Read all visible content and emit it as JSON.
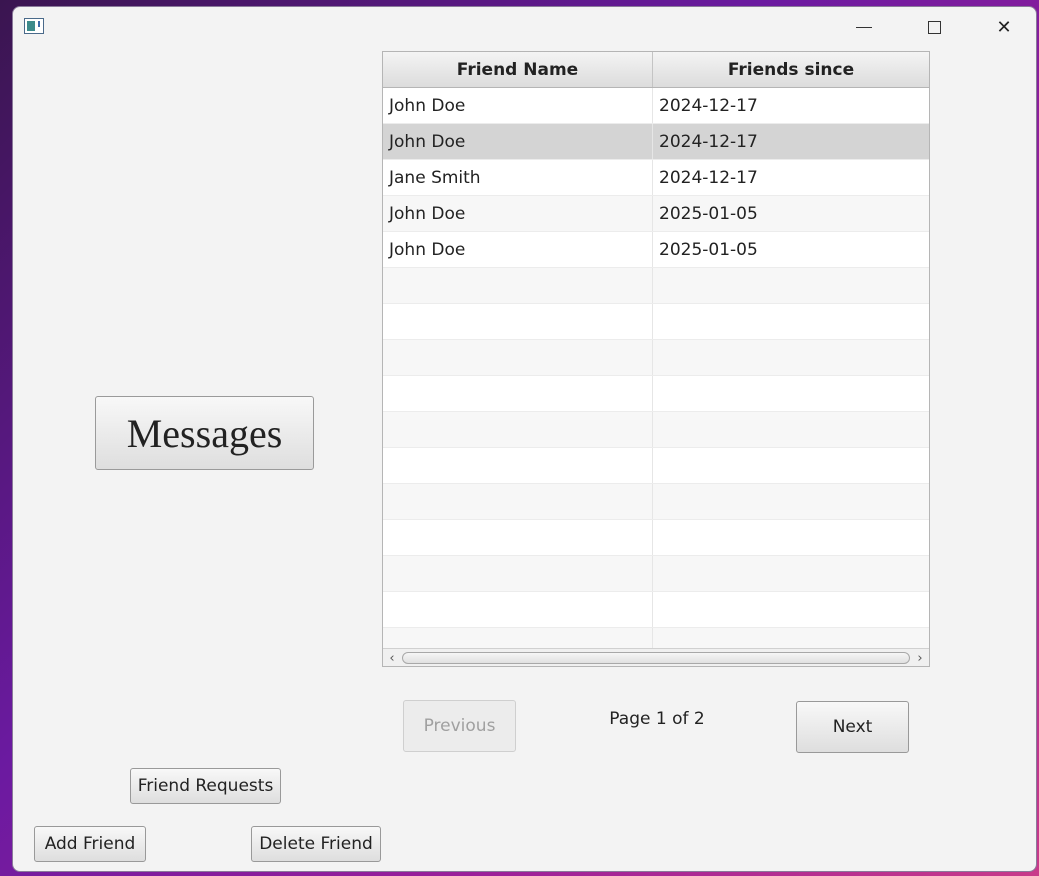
{
  "window": {
    "controls": {
      "minimize": "minimize",
      "maximize": "maximize",
      "close": "close"
    }
  },
  "messages_button": "Messages",
  "table": {
    "columns": [
      "Friend Name",
      "Friends since"
    ],
    "rows": [
      [
        "John Doe",
        "2024-12-17"
      ],
      [
        "John Doe",
        "2024-12-17"
      ],
      [
        "Jane Smith",
        "2024-12-17"
      ],
      [
        "John Doe",
        "2025-01-05"
      ],
      [
        "John Doe",
        "2025-01-05"
      ]
    ],
    "selected_row": 1,
    "empty_rows": 11
  },
  "pagination": {
    "previous_label": "Previous",
    "previous_enabled": false,
    "page_label": "Page 1 of 2",
    "next_label": "Next"
  },
  "actions": {
    "friend_requests_label": "Friend Requests",
    "add_friend_label": "Add Friend",
    "delete_friend_label": "Delete Friend"
  },
  "colors": {
    "window_bg": "#f3f3f3",
    "selected_row": "#d4d4d4"
  }
}
